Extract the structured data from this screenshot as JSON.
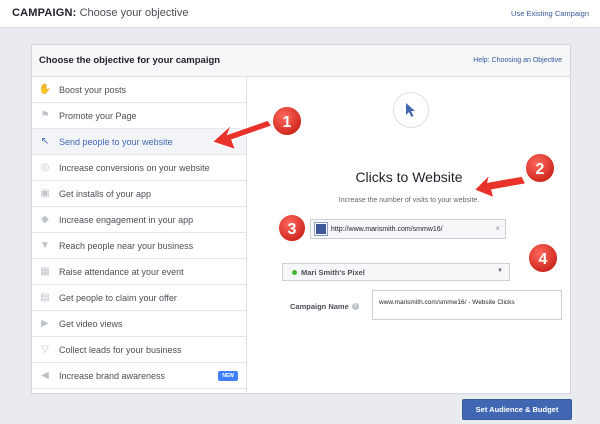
{
  "header": {
    "title_prefix": "CAMPAIGN:",
    "title_rest": " Choose your objective",
    "use_existing_link": "Use Existing Campaign"
  },
  "panel": {
    "title": "Choose the objective for your campaign",
    "help_link": "Help: Choosing an Objective"
  },
  "objectives": [
    {
      "label": "Boost your posts",
      "icon": "thumbs-up-icon",
      "selected": false
    },
    {
      "label": "Promote your Page",
      "icon": "flag-icon",
      "selected": false
    },
    {
      "label": "Send people to your website",
      "icon": "cursor-icon",
      "selected": true
    },
    {
      "label": "Increase conversions on your website",
      "icon": "globe-icon",
      "selected": false
    },
    {
      "label": "Get installs of your app",
      "icon": "box-icon",
      "selected": false
    },
    {
      "label": "Increase engagement in your app",
      "icon": "gamepad-icon",
      "selected": false
    },
    {
      "label": "Reach people near your business",
      "icon": "map-pin-icon",
      "selected": false
    },
    {
      "label": "Raise attendance at your event",
      "icon": "calendar-icon",
      "selected": false
    },
    {
      "label": "Get people to claim your offer",
      "icon": "offer-tag-icon",
      "selected": false
    },
    {
      "label": "Get video views",
      "icon": "video-camera-icon",
      "selected": false
    },
    {
      "label": "Collect leads for your business",
      "icon": "filter-funnel-icon",
      "selected": false
    },
    {
      "label": "Increase brand awareness",
      "icon": "megaphone-icon",
      "selected": false,
      "badge": "NEW"
    }
  ],
  "detail": {
    "title": "Clicks to Website",
    "description": "Increase the number of visits to your website.",
    "url_value": "http://www.marismith.com/smmw16/",
    "clear_symbol": "×",
    "pixel_label": "Mari Smith's Pixel",
    "pixel_caret": "▼",
    "campaign_name_label": "Campaign Name",
    "info_symbol": "i",
    "campaign_name_value": "www.marismith.com/smmw16/ - Website Clicks"
  },
  "footer": {
    "cta_label": "Set Audience & Budget"
  },
  "annotations": [
    {
      "number": "1"
    },
    {
      "number": "2"
    },
    {
      "number": "3"
    },
    {
      "number": "4"
    }
  ],
  "colors": {
    "accent": "#4267b2",
    "annotation_red": "#e8322a",
    "page_bg": "#e9ebee"
  }
}
